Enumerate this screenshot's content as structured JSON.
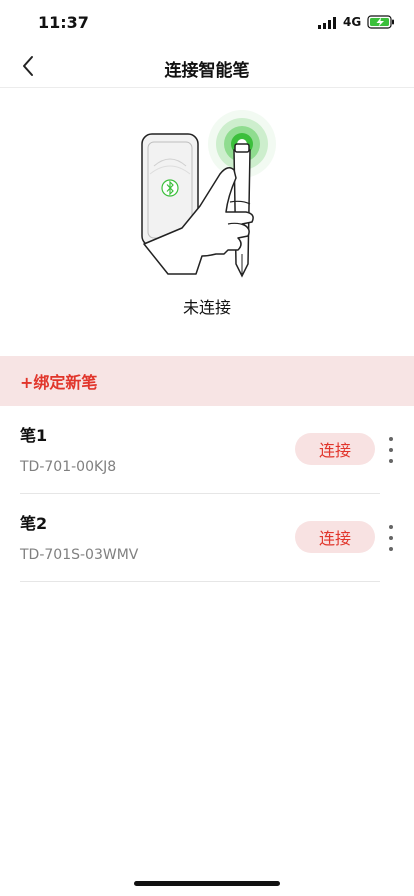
{
  "status_bar": {
    "time": "11:37",
    "network": "4G",
    "icons": [
      "signal-icon",
      "battery-charging-icon"
    ],
    "battery_color": "#3bbf3b"
  },
  "nav": {
    "title": "连接智能笔",
    "back_icon": "chevron-left-icon"
  },
  "illustration": {
    "icons": [
      "hand-holding-pen-icon",
      "bluetooth-icon",
      "pulse-icon"
    ],
    "pulse_color": "#3bbf3b"
  },
  "connection": {
    "status": "未连接"
  },
  "bind": {
    "label": "+绑定新笔",
    "accent": "#e1352b"
  },
  "pens": [
    {
      "name": "笔1",
      "id": "TD-701-00KJ8",
      "button": "连接"
    },
    {
      "name": "笔2",
      "id": "TD-701S-03WMV",
      "button": "连接"
    }
  ]
}
